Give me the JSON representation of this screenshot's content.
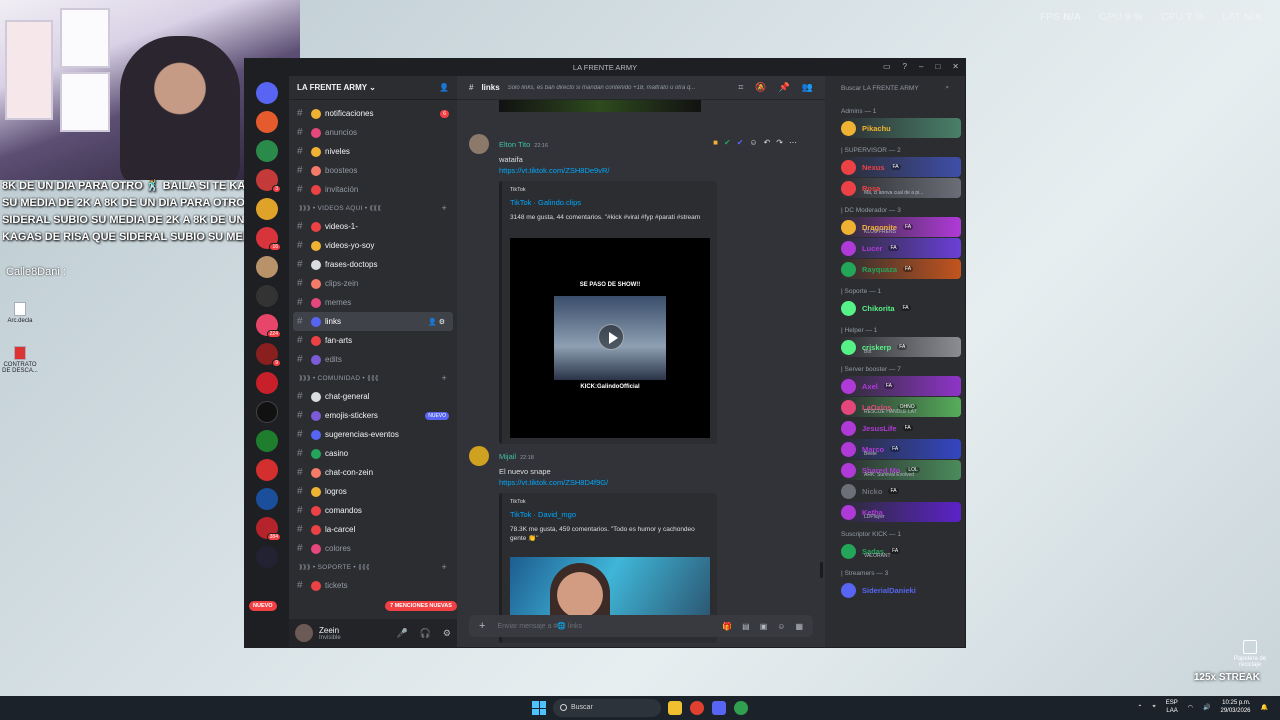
{
  "overlay": {
    "fps_label": "FPS",
    "fps_value": "N/A",
    "gpu_label": "GPU",
    "gpu_value": "9 %",
    "cpu_label": "CPU",
    "cpu_value": "7 %",
    "lat_label": "LAT",
    "lat_value": "N/A"
  },
  "stream": {
    "captions": [
      "8K DE UN DIA PARA OTRO 🕺 BAILA SI TE KAGAS DE RISA",
      "SU MEDIA DE 2K A 8K DE UN DIA PARA OTRO 🕺 BAILA SI",
      "SIDERAL SUBIO SU MEDIA DE 2K A 8K DE UN DIA PARA OTRO",
      "KAGAS DE RISA QUE SIDERAL SUBIO SU MEDIA DE 2K A 8K"
    ],
    "chat_user": "Calle8Dani :",
    "streak": "125x STREAK"
  },
  "desktop": {
    "icons": [
      "Arc.decla",
      "CONTRATO DE DESCA..."
    ],
    "recycle": "Papelera de reciclaje"
  },
  "window": {
    "title": "LA FRENTE ARMY"
  },
  "sidebar": {
    "server_name": "LA FRENTE ARMY",
    "mentions_pill": "7 MENCIONES NUEVAS",
    "new_pill": "NUEVO",
    "channels": [
      {
        "name": "notificaciones",
        "color": "#f0b232",
        "unread": true,
        "badge": "6"
      },
      {
        "name": "anuncios",
        "color": "#e4477b"
      },
      {
        "name": "niveles",
        "color": "#f0b232",
        "unread": true
      },
      {
        "name": "boosteos",
        "color": "#f47b67"
      },
      {
        "name": "invitación",
        "color": "#ed4245"
      }
    ],
    "cat1": "⟫⟫⟫ • VIDEOS AQUI • ⟪⟪⟪",
    "channels2": [
      {
        "name": "videos-1-",
        "color": "#ed4245",
        "unread": true
      },
      {
        "name": "videos-yo-soy",
        "color": "#f0b232",
        "unread": true
      },
      {
        "name": "frases-doctops",
        "color": "#dbdee1",
        "unread": true
      },
      {
        "name": "clips-zein",
        "color": "#f47b67"
      },
      {
        "name": "memes",
        "color": "#e4477b"
      },
      {
        "name": "links",
        "color": "#5865f2",
        "active": true
      },
      {
        "name": "fan-arts",
        "color": "#ed4245",
        "unread": true
      },
      {
        "name": "edits",
        "color": "#7d5bd6"
      }
    ],
    "cat2": "⟫⟫⟫ • COMUNIDAD • ⟪⟪⟪",
    "channels3": [
      {
        "name": "chat-general",
        "color": "#dbdee1",
        "unread": true
      },
      {
        "name": "emojis-stickers",
        "color": "#7d5bd6",
        "unread": true,
        "newbadge": "NUEVO"
      },
      {
        "name": "sugerencias-eventos",
        "color": "#5865f2",
        "unread": true
      },
      {
        "name": "casino",
        "color": "#23a55a",
        "unread": true
      },
      {
        "name": "chat-con-zein",
        "color": "#f47b67",
        "unread": true
      },
      {
        "name": "logros",
        "color": "#f0b232",
        "unread": true
      },
      {
        "name": "comandos",
        "color": "#ed4245",
        "unread": true
      },
      {
        "name": "la-carcel",
        "color": "#ed4245",
        "unread": true
      },
      {
        "name": "colores",
        "color": "#e4477b"
      }
    ],
    "cat3": "⟫⟫⟫ • SOPORTE • ⟪⟪⟪",
    "channels4": [
      {
        "name": "tickets",
        "color": "#ed4245"
      }
    ],
    "user": {
      "name": "Zeein",
      "status": "Invisible"
    }
  },
  "chat": {
    "channel": "links",
    "topic": "Solo links, es ban directo si mandan contenido +18, maltrato u otra q...",
    "messages": [
      {
        "author": "Elton Tito",
        "time": "22:16",
        "text": "wataifa",
        "link": "https://vt.tiktok.com/ZSH8De9vR/",
        "provider": "TikTok",
        "embed_author": "TikTok · Galindo.clips",
        "desc": "3148 me gusta, 44 comentarios. \"#kick #viral #fyp #parati #stream",
        "video_top": "SE PASO DE SHOW!!",
        "video_bottom": "KICK:GalindoOfficial"
      },
      {
        "author": "Mijail",
        "time": "22:18",
        "text": "El nuevo snape",
        "link": "https://vt.tiktok.com/ZSH8D4f9G/",
        "provider": "TikTok",
        "embed_author": "TikTok · David_mgo",
        "desc": "78.3K me gusta, 459 comentarios. \"Todo es humor y cachondeo gente 👏\""
      }
    ],
    "composer_placeholder": "Enviar mensaje a #🌐 links"
  },
  "members": {
    "search_placeholder": "Buscar LA FRENTE ARMY",
    "groups": [
      {
        "title": "Admins — 1",
        "members": [
          {
            "name": "Pikachu",
            "color": "#f0b232",
            "bg": "linear-gradient(90deg,#2b2d31,#49806a)"
          }
        ]
      },
      {
        "title": "| SUPERVISOR — 2",
        "members": [
          {
            "name": "Nexus",
            "color": "#ed4245",
            "tag": "FA",
            "bg": "linear-gradient(90deg,#2b2d31,#3f4ea8)"
          },
          {
            "name": "Rosa",
            "color": "#ed4245",
            "sub": "Ma, cl anova cual de a pi...",
            "bg": "linear-gradient(90deg,#2b2d31,#6b6e77)"
          }
        ]
      },
      {
        "title": "| DC Moderador — 3",
        "members": [
          {
            "name": "Dragonite",
            "color": "#f0b232",
            "tag": "FA",
            "sub": "KLOU FRENS",
            "bg": "linear-gradient(90deg,#2b2d31,#b03ad8)"
          },
          {
            "name": "Lucer",
            "color": "#b03ad8",
            "tag": "FA",
            "bg": "linear-gradient(90deg,#2b2d31,#6a3fd8)"
          },
          {
            "name": "Rayquaza",
            "color": "#23a55a",
            "tag": "FA",
            "bg": "linear-gradient(90deg,#2b2d31,#c3541e)"
          }
        ]
      },
      {
        "title": "| Soporte — 1",
        "members": [
          {
            "name": "Chikorita",
            "color": "#57f287",
            "tag": "FA"
          }
        ]
      },
      {
        "title": "| Helper — 1",
        "members": [
          {
            "name": "criskerp",
            "color": "#57f287",
            "tag": "FA",
            "sub": "Bot",
            "bg": "linear-gradient(90deg,#2b2d31,#8b8d92)"
          }
        ]
      },
      {
        "title": "| Server booster — 7",
        "members": [
          {
            "name": "Axel",
            "color": "#b03ad8",
            "tag": "FA",
            "bg": "linear-gradient(90deg,#2b2d31,#8f34c8)"
          },
          {
            "name": "LaOxlos",
            "color": "#e4477b",
            "tag": "OHNO",
            "sub": "RESCUE HANDLE LAT",
            "bg": "linear-gradient(90deg,#2b2d31,#56ad5a)"
          },
          {
            "name": "JesusLife",
            "color": "#b03ad8",
            "tag": "FA"
          },
          {
            "name": "Marco",
            "color": "#b03ad8",
            "tag": "FA",
            "sub": "Beele",
            "bg": "linear-gradient(90deg,#2b2d31,#3446c2)"
          },
          {
            "name": "Shared Mo",
            "color": "#b03ad8",
            "tag": "LOL",
            "sub": "ARK: Survival Evolved",
            "bg": "linear-gradient(90deg,#2b2d31,#4b8b5a)"
          },
          {
            "name": "Nicko",
            "color": "#6d6f78",
            "tag": "FA"
          },
          {
            "name": "Ketha",
            "color": "#b03ad8",
            "sub": "LDPlayer",
            "bg": "linear-gradient(90deg,#2b2d31,#5c22c8)"
          }
        ]
      },
      {
        "title": "Suscriptor KICK — 1",
        "members": [
          {
            "name": "Sadas",
            "color": "#23a55a",
            "tag": "FA",
            "sub": "VALORANT"
          }
        ]
      },
      {
        "title": "| Streamers — 3",
        "members": [
          {
            "name": "SiderialDanieki",
            "color": "#5865f2"
          }
        ]
      }
    ]
  },
  "taskbar": {
    "search": "Buscar",
    "lang1": "ESP",
    "lang2": "LAA",
    "time": "10:25 p.m.",
    "date": "29/03/2026"
  }
}
